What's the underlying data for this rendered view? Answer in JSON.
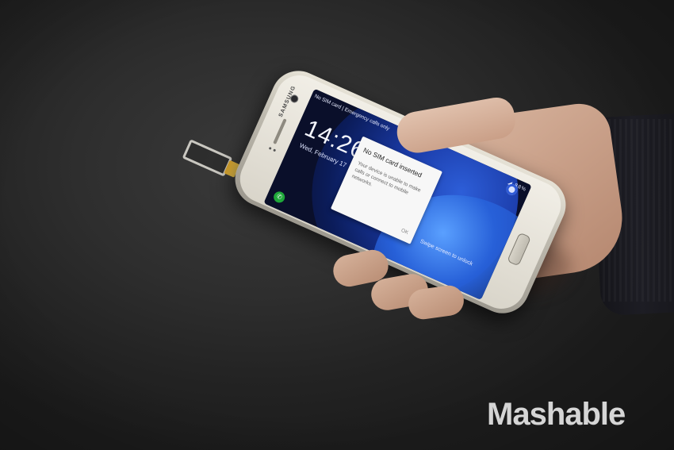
{
  "photo": {
    "subject": "hand-holding-phone-with-sim-tray-ejected"
  },
  "phone": {
    "brand": "SAMSUNG",
    "status_left": "No SIM card | Emergency calls only",
    "status_icons": "◢ 88%",
    "clock": "14:26",
    "date": "Wed, February 17",
    "swipe_hint": "Swipe screen to unlock"
  },
  "dialog": {
    "title": "No SIM card inserted",
    "body": "Your device is unable to make calls or connect to mobile networks.",
    "ok_label": "OK"
  },
  "watermark": {
    "text": "Mashable"
  }
}
